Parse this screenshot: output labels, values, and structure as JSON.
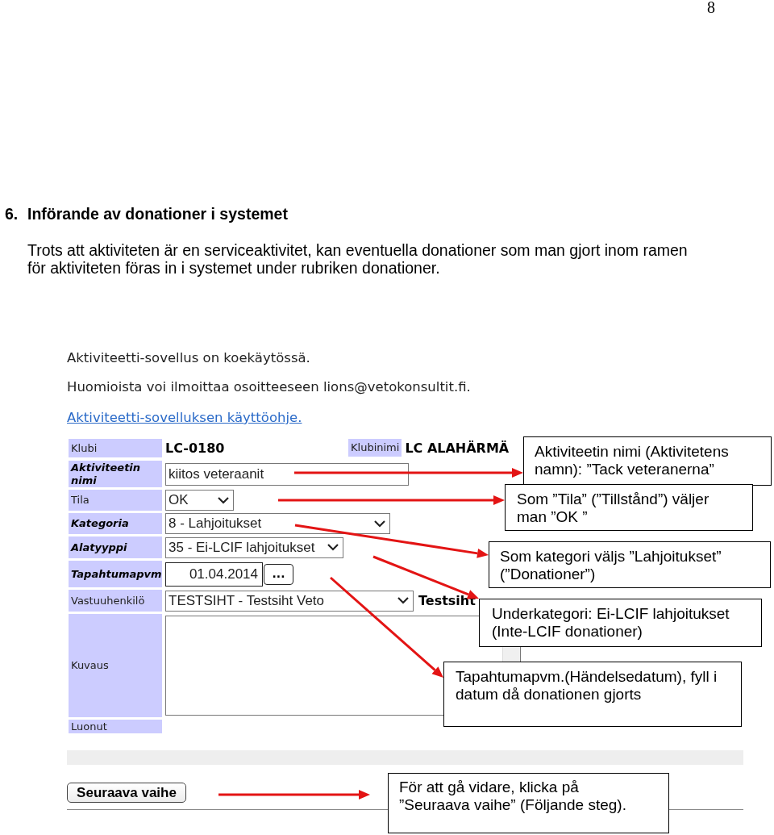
{
  "page_number": "8",
  "section": {
    "number": "6.",
    "title": "Införande av donationer i systemet"
  },
  "intro": "Trots att aktiviteten är en serviceaktivitet, kan eventuella donationer som man gjort inom ramen för aktiviteten föras in i systemet under rubriken donationer.",
  "screenshot": {
    "notices": [
      "Aktiviteetti-sovellus on koekäytössä.",
      "Huomioista voi ilmoittaa osoitteeseen lions@vetokonsultit.fi."
    ],
    "help_link": "Aktiviteetti-sovelluksen käyttöohje.",
    "fields": [
      {
        "label": "Klubi",
        "required": false,
        "kind": "static",
        "value": "LC-0180",
        "extra_label": "Klubinimi",
        "extra_value": "LC ALAHÄRMÄ"
      },
      {
        "label": "Aktiviteetin nimi",
        "required": true,
        "kind": "input",
        "value": "kiitos veteraanit"
      },
      {
        "label": "Tila",
        "required": false,
        "kind": "select",
        "value": "OK"
      },
      {
        "label": "Kategoria",
        "required": true,
        "kind": "select",
        "value": "8 - Lahjoitukset"
      },
      {
        "label": "Alatyyppi",
        "required": true,
        "kind": "select",
        "value": "35 - Ei-LCIF lahjoitukset"
      },
      {
        "label": "Tapahtumapvm",
        "required": true,
        "kind": "date",
        "value": "01.04.2014",
        "button": "..."
      },
      {
        "label": "Vastuuhenkilö",
        "required": false,
        "kind": "select",
        "value": "TESTSIHT - Testsiht Veto",
        "extra_value": "Testsiht"
      },
      {
        "label": "Kuvaus",
        "required": false,
        "kind": "textarea"
      },
      {
        "label": "Luonut",
        "required": false,
        "kind": "empty"
      }
    ],
    "next_button": "Seuraava vaihe"
  },
  "callouts": [
    "Aktiviteetin nimi (Aktivitetens namn): ”Tack veteranerna”",
    "Som ”Tila” (”Tillstånd”) väljer man ”OK ”",
    "Som kategori väljs ”Lahjoitukset” (”Donationer”)",
    "Underkategori: Ei-LCIF lahjoitukset (Inte-LCIF donationer)",
    "Tapahtumapvm.(Händelsedatum), fyll i datum då donationen gjorts",
    "För att gå vidare, klicka på ”Seuraava vaihe” (Följande steg)."
  ]
}
